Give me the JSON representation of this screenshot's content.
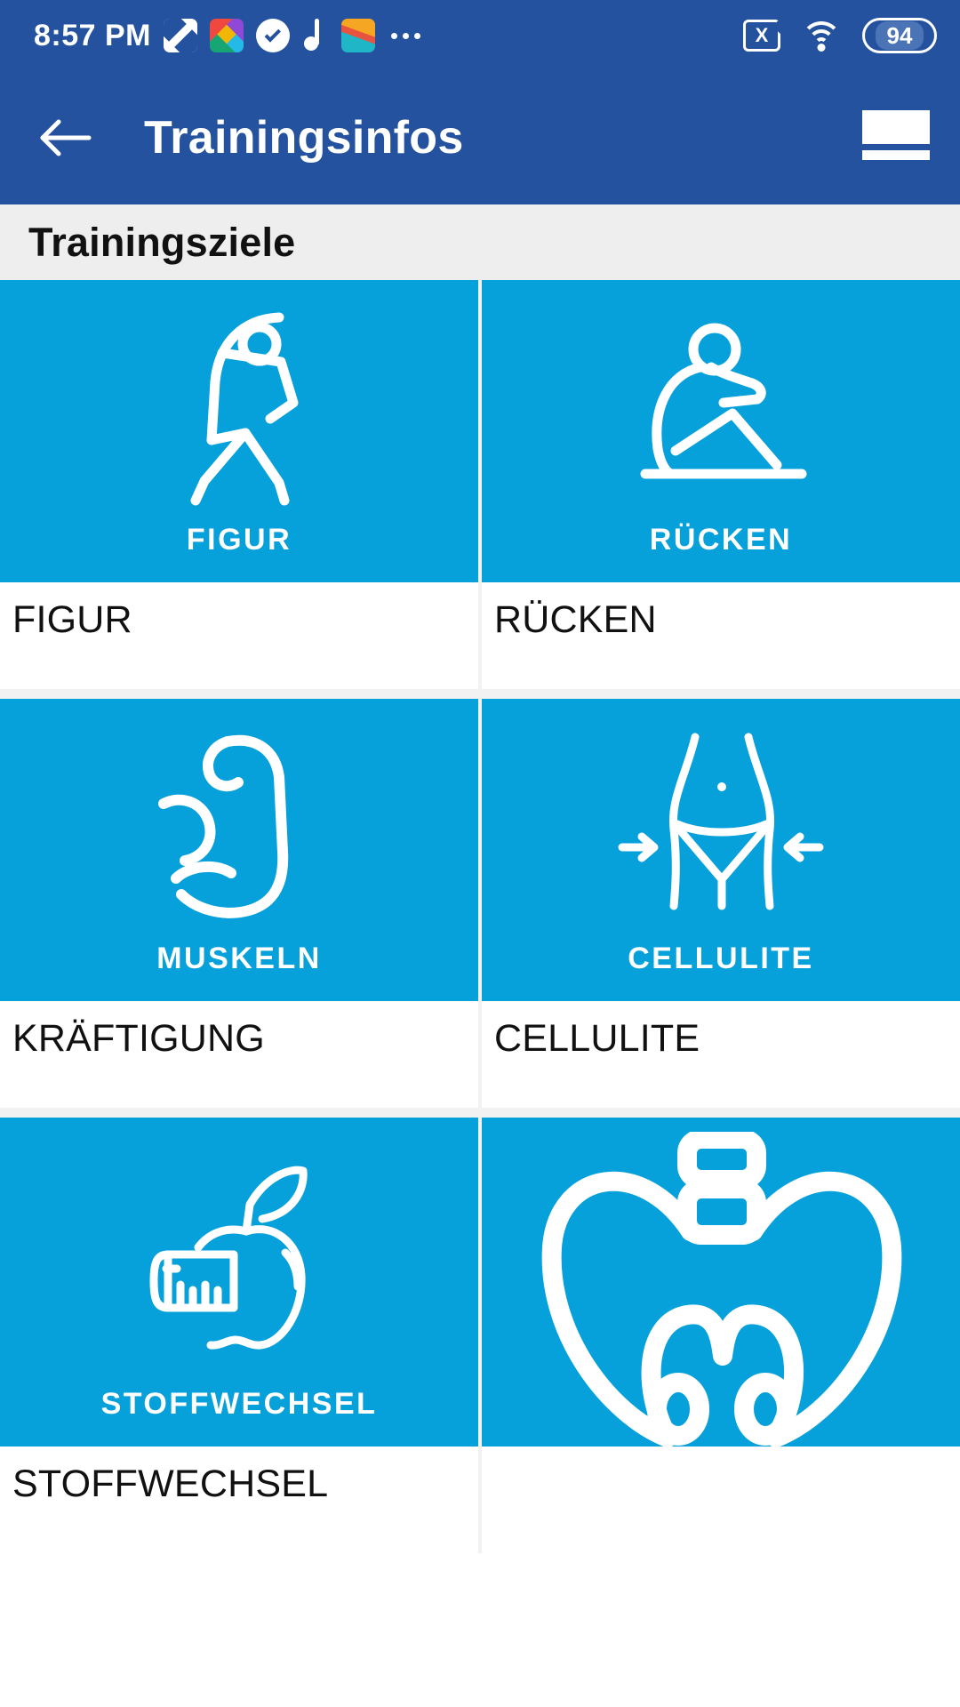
{
  "status_bar": {
    "time": "8:57 PM",
    "battery_level": "94",
    "icons": [
      "megasync-icon",
      "photo-editor-icon",
      "check-circle-icon",
      "music-note-icon",
      "gallery-icon",
      "more-dots-icon"
    ],
    "right_icons": [
      "sim-card-error-icon",
      "wifi-icon",
      "battery-icon"
    ],
    "sim_glyph": "X"
  },
  "app_bar": {
    "back_label": "back-arrow",
    "title": "Trainingsinfos",
    "menu_label": "menu-icon"
  },
  "section": {
    "title": "Trainingsziele"
  },
  "colors": {
    "status_bar_bg": "#24529f",
    "app_bar_bg": "#24529f",
    "section_bg": "#eeeeee",
    "tile_blue": "#06a0db",
    "page_bg": "#f2f2f2",
    "text_dark": "#111111",
    "text_light": "#ffffff"
  },
  "cards": [
    {
      "tile_label": "FIGUR",
      "caption": "FIGUR",
      "icon": "walking-stretching-figure-icon"
    },
    {
      "tile_label": "RÜCKEN",
      "caption": "RÜCKEN",
      "icon": "seated-back-stretch-icon"
    },
    {
      "tile_label": "MUSKELN",
      "caption": "KRÄFTIGUNG",
      "icon": "flexed-bicep-icon"
    },
    {
      "tile_label": "CELLULITE",
      "caption": "CELLULITE",
      "icon": "waist-slimming-icon"
    },
    {
      "tile_label": "STOFFWECHSEL",
      "caption": "STOFFWECHSEL",
      "icon": "apple-measuring-tape-icon"
    },
    {
      "tile_label": "",
      "caption": "",
      "icon": "pelvic-floor-icon"
    }
  ]
}
